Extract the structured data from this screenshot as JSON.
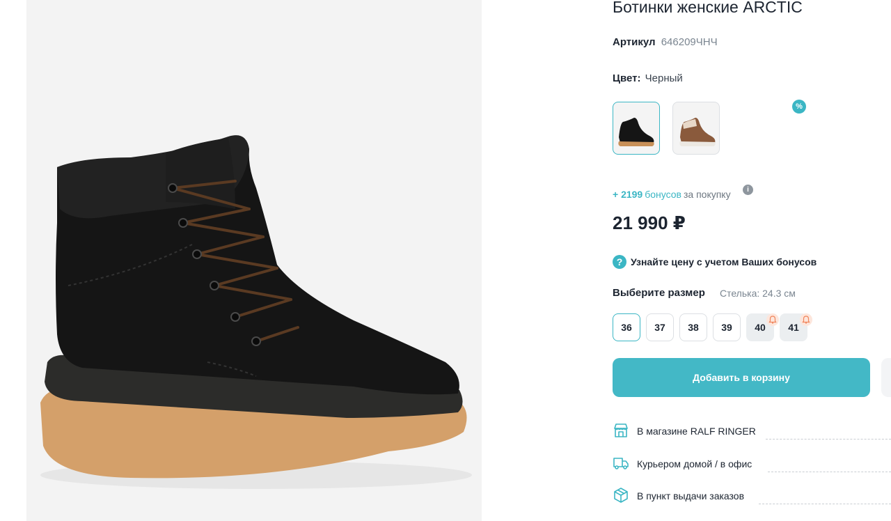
{
  "product": {
    "title": "Ботинки женские ARCTIC",
    "sku_label": "Артикул",
    "sku_value": "646209ЧНЧ",
    "color_label": "Цвет:",
    "color_value": "Черный",
    "color_options": [
      {
        "color": "black",
        "selected": true
      },
      {
        "color": "brown",
        "selected": false,
        "badge": "%"
      }
    ]
  },
  "bonus": {
    "amount": "+ 2199",
    "word": "бонусов",
    "tail": "за покупку",
    "info_icon": "i"
  },
  "price": "21 990 ₽",
  "bonus_hint": {
    "icon": "?",
    "text": "Узнайте цену с учетом Ваших бонусов"
  },
  "sizes": {
    "title": "Выберите размер",
    "insole": "Стелька: 24.3 см",
    "options": [
      {
        "label": "36",
        "state": "selected"
      },
      {
        "label": "37",
        "state": "available"
      },
      {
        "label": "38",
        "state": "available"
      },
      {
        "label": "39",
        "state": "available"
      },
      {
        "label": "40",
        "state": "unavailable",
        "notify_icon": "bell-icon"
      },
      {
        "label": "41",
        "state": "unavailable",
        "notify_icon": "bell-icon"
      }
    ]
  },
  "cart_button": "Добавить в корзину",
  "delivery": [
    {
      "icon": "store-icon",
      "label": "В магазине RALF RINGER"
    },
    {
      "icon": "truck-icon",
      "label": "Курьером домой / в офис"
    },
    {
      "icon": "box-icon",
      "label": "В пункт выдачи заказов"
    }
  ],
  "colors": {
    "accent": "#43b8c6",
    "text": "#1c2430",
    "muted": "#7a8590",
    "notify": "#f0845a"
  }
}
